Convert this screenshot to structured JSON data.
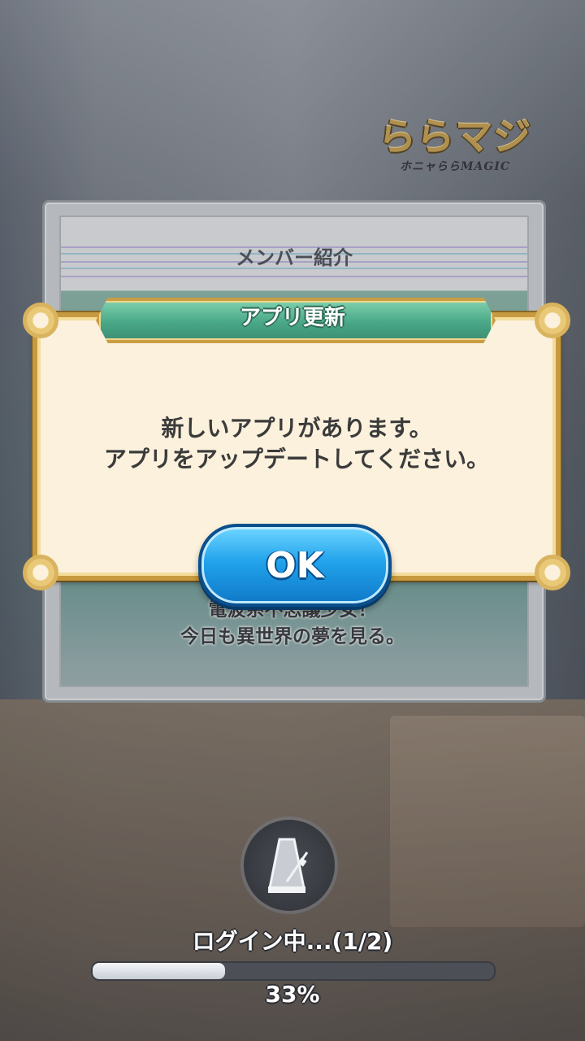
{
  "logo": {
    "main": "ららマジ",
    "sub": "ホニャららMAGIC"
  },
  "member_card": {
    "title": "メンバー紹介",
    "description_line1": "電波系不思議少女！",
    "description_line2": "今日も異世界の夢を見る。"
  },
  "dialog": {
    "title": "アプリ更新",
    "message_line1": "新しいアプリがあります。",
    "message_line2": "アプリをアップデートしてください。",
    "ok_label": "OK"
  },
  "loading": {
    "status": "ログイン中...(1/2)",
    "progress_fraction": 0.33,
    "percent_label": "33%",
    "icon": "metronome-icon"
  },
  "colors": {
    "dialog_bg": "#fbf1dc",
    "dialog_border": "#c79a3f",
    "title_bar": "#49a888",
    "ok_button": "#22a3ec"
  }
}
